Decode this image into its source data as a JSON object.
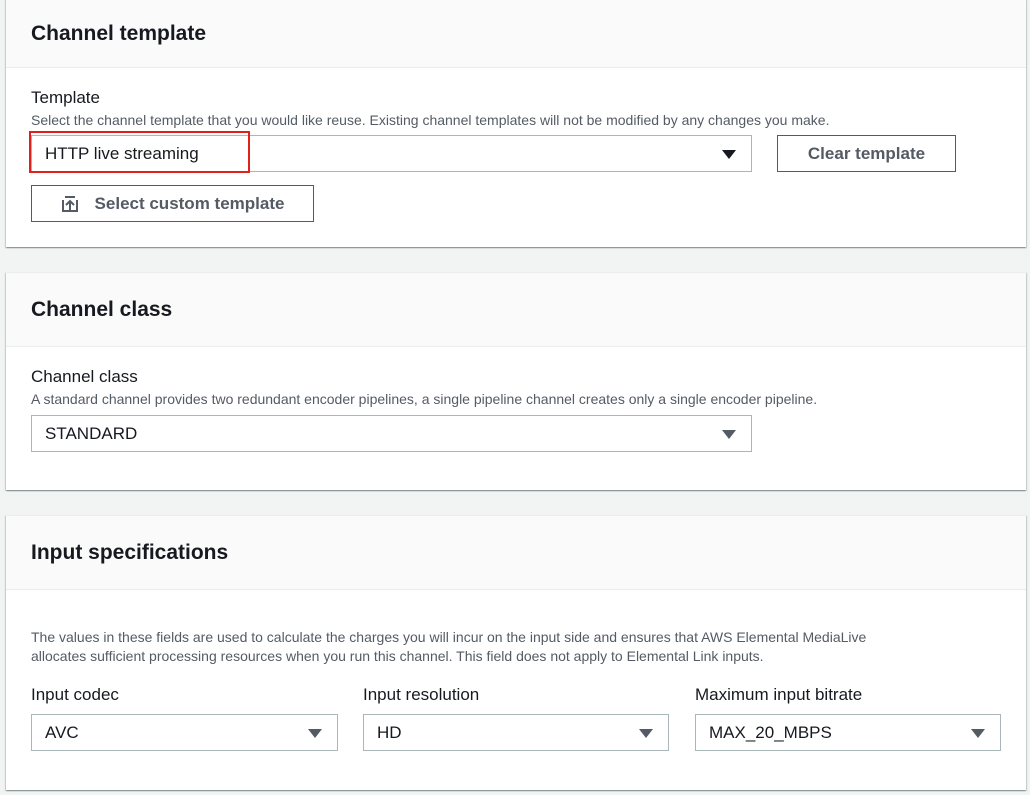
{
  "channel_template": {
    "title": "Channel template",
    "label": "Template",
    "description": "Select the channel template that you would like reuse. Existing channel templates will not be modified by any changes you make.",
    "selected": "HTTP live streaming",
    "clear_button": "Clear template",
    "custom_button": "Select custom template"
  },
  "channel_class": {
    "title": "Channel class",
    "label": "Channel class",
    "description": "A standard channel provides two redundant encoder pipelines, a single pipeline channel creates only a single encoder pipeline.",
    "selected": "STANDARD"
  },
  "input_specifications": {
    "title": "Input specifications",
    "description_line1": "The values in these fields are used to calculate the charges you will incur on the input side and ensures that AWS Elemental MediaLive",
    "description_line2": "allocates sufficient processing resources when you run this channel. This field does not apply to Elemental Link inputs.",
    "codec": {
      "label": "Input codec",
      "selected": "AVC"
    },
    "resolution": {
      "label": "Input resolution",
      "selected": "HD"
    },
    "bitrate": {
      "label": "Maximum input bitrate",
      "selected": "MAX_20_MBPS"
    }
  },
  "colors": {
    "highlight": "#e0201b",
    "border": "#aab7b8",
    "text": "#16191f",
    "secondary_text": "#545b64"
  }
}
